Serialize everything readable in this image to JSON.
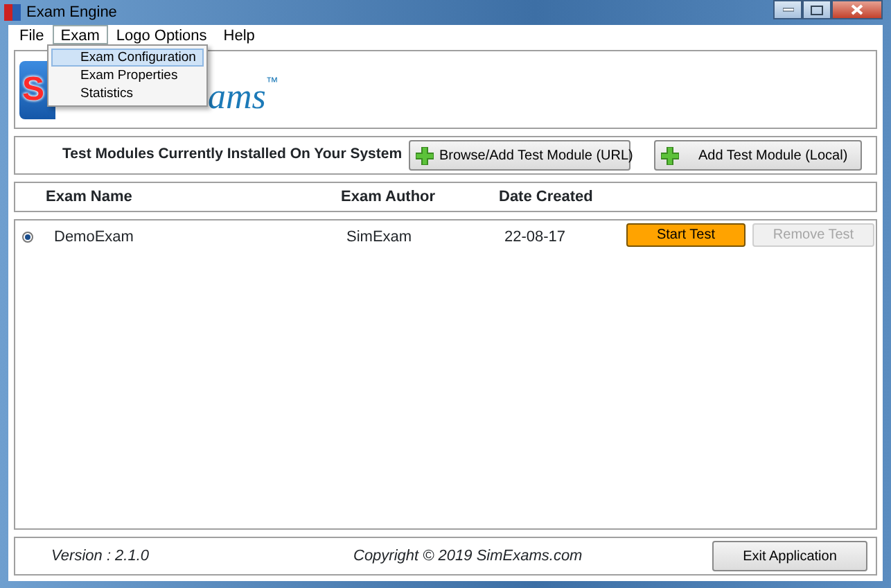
{
  "window": {
    "title": "Exam Engine"
  },
  "menu_bar": [
    {
      "label": "File",
      "selected": false
    },
    {
      "label": "Exam",
      "selected": true
    },
    {
      "label": "Logo Options",
      "selected": false
    },
    {
      "label": "Help",
      "selected": false
    }
  ],
  "dropdown": [
    {
      "label": "Exam Configuration",
      "selected": true
    },
    {
      "label": "Exam Properties",
      "selected": false
    },
    {
      "label": "Statistics",
      "selected": false
    }
  ],
  "logo": {
    "letter": "S",
    "text": "ams",
    "trademark": "™"
  },
  "toolbar": {
    "heading": "Test Modules Currently Installed On Your System",
    "buttons": [
      "Browse/Add Test Module (URL)",
      "Add Test Module (Local)"
    ]
  },
  "table": {
    "columns": [
      "Exam Name",
      "Exam Author",
      "Date Created"
    ],
    "rows": [
      {
        "selected": true,
        "cells": [
          "DemoExam",
          "SimExam",
          "22-08-17"
        ],
        "start": {
          "label": "Start Test",
          "disabled": false
        },
        "remove": {
          "label": "Remove Test",
          "disabled": true
        }
      }
    ]
  },
  "footer": {
    "version": "Version : 2.1.0",
    "copyright": "Copyright © 2019 SimExams.com",
    "exit": "Exit Application"
  }
}
